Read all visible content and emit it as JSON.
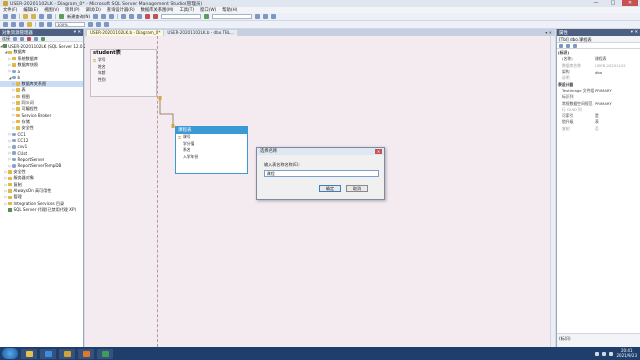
{
  "window": {
    "title": "USER-20201102LK - Diagram_0* - Microsoft SQL Server Management Studio(管理员)",
    "controls": [
      "—",
      "□",
      "✕"
    ]
  },
  "menu": [
    "文件(F)",
    "编辑(E)",
    "视图(V)",
    "项目(P)",
    "调试(D)",
    "查询设计器(R)",
    "数据库关系图(M)",
    "工具(T)",
    "窗口(W)",
    "帮助(H)"
  ],
  "toolbar": {
    "new_query": "新建查询(N)",
    "zoom_value": "100%"
  },
  "object_explorer": {
    "title": "对象资源管理器",
    "connect_label": "连接",
    "tree": [
      {
        "text": "USER-20201102LK (SQL Server 12.0.2",
        "icon": "server-icon",
        "level": 0
      },
      {
        "text": "数据库",
        "icon": "folder-icon",
        "level": 1
      },
      {
        "text": "系统数据库",
        "icon": "folder-icon",
        "level": 2
      },
      {
        "text": "数据库快照",
        "icon": "folder-icon",
        "level": 2
      },
      {
        "text": "a",
        "icon": "database-icon",
        "level": 2
      },
      {
        "text": "b",
        "icon": "database-icon",
        "level": 2
      },
      {
        "text": "数据库关系图",
        "icon": "folder-icon",
        "level": 3
      },
      {
        "text": "表",
        "icon": "folder-icon",
        "level": 3
      },
      {
        "text": "视图",
        "icon": "folder-icon",
        "level": 3
      },
      {
        "text": "同义词",
        "icon": "folder-icon",
        "level": 3
      },
      {
        "text": "可编程性",
        "icon": "folder-icon",
        "level": 3
      },
      {
        "text": "Service Broker",
        "icon": "folder-icon",
        "level": 3
      },
      {
        "text": "存储",
        "icon": "folder-icon",
        "level": 3
      },
      {
        "text": "安全性",
        "icon": "folder-icon",
        "level": 3
      },
      {
        "text": "CC1",
        "icon": "database-icon",
        "level": 2
      },
      {
        "text": "CC12",
        "icon": "database-icon",
        "level": 2
      },
      {
        "text": "cvv1",
        "icon": "database-icon",
        "level": 2
      },
      {
        "text": "CUst",
        "icon": "database-icon",
        "level": 2
      },
      {
        "text": "ReportServer",
        "icon": "database-icon",
        "level": 2
      },
      {
        "text": "ReportServerTempDB",
        "icon": "database-icon",
        "level": 2
      },
      {
        "text": "安全性",
        "icon": "folder-icon",
        "level": 1
      },
      {
        "text": "服务器对象",
        "icon": "folder-icon",
        "level": 1
      },
      {
        "text": "复制",
        "icon": "folder-icon",
        "level": 1
      },
      {
        "text": "AlwaysOn 高可用性",
        "icon": "folder-icon",
        "level": 1
      },
      {
        "text": "管理",
        "icon": "folder-icon",
        "level": 1
      },
      {
        "text": "Integration Services 目录",
        "icon": "folder-icon",
        "level": 1
      },
      {
        "text": "SQL Server 代理(已禁用代理 XP)",
        "icon": "agent-icon",
        "level": 1
      }
    ]
  },
  "tabs": [
    {
      "label": "USER-20201102LK.b - Diagram_0*",
      "active": true
    },
    {
      "label": "USER-20201102LK.b - dbo.TBL...",
      "active": false
    }
  ],
  "diagram": {
    "student_table": {
      "title": "student表",
      "columns": [
        "学号",
        "姓名",
        "年龄",
        "性别"
      ]
    },
    "new_table": {
      "title": "课程表",
      "columns": [
        "课号",
        "学分值",
        "系名",
        "入学年份"
      ]
    }
  },
  "dialog": {
    "title": "选择名称",
    "prompt": "输入表名称名称(E):",
    "input_value": "课程",
    "ok_label": "确定",
    "cancel_label": "取消"
  },
  "properties": {
    "title": "属性",
    "object": "[Tbl] dbo.课程表",
    "rows": [
      {
        "key": "(标识)",
        "value": "",
        "category": true
      },
      {
        "key": "(名称)",
        "value": "课程表",
        "dim": false
      },
      {
        "key": "数据库名称",
        "value": "USER-20201102",
        "dim": true
      },
      {
        "key": "架构",
        "value": "dbo",
        "dim": false
      },
      {
        "key": "说明",
        "value": "",
        "dim": true
      },
      {
        "key": "表设计器",
        "value": "",
        "category": true
      },
      {
        "key": "TextImage 文件组",
        "value": "PRIMARY",
        "dim": false
      },
      {
        "key": "标识列",
        "value": "",
        "dim": false
      },
      {
        "key": "常规数据空间规范",
        "value": "PRIMARY",
        "dim": false
      },
      {
        "key": "行 GUID 列",
        "value": "",
        "dim": true
      },
      {
        "key": "可索引",
        "value": "是",
        "dim": false
      },
      {
        "key": "锁升级",
        "value": "表",
        "dim": false
      },
      {
        "key": "复制",
        "value": "否",
        "dim": true
      }
    ],
    "description": "(标识)"
  },
  "taskbar": {
    "time": "20:41",
    "date": "2021/9/23"
  }
}
